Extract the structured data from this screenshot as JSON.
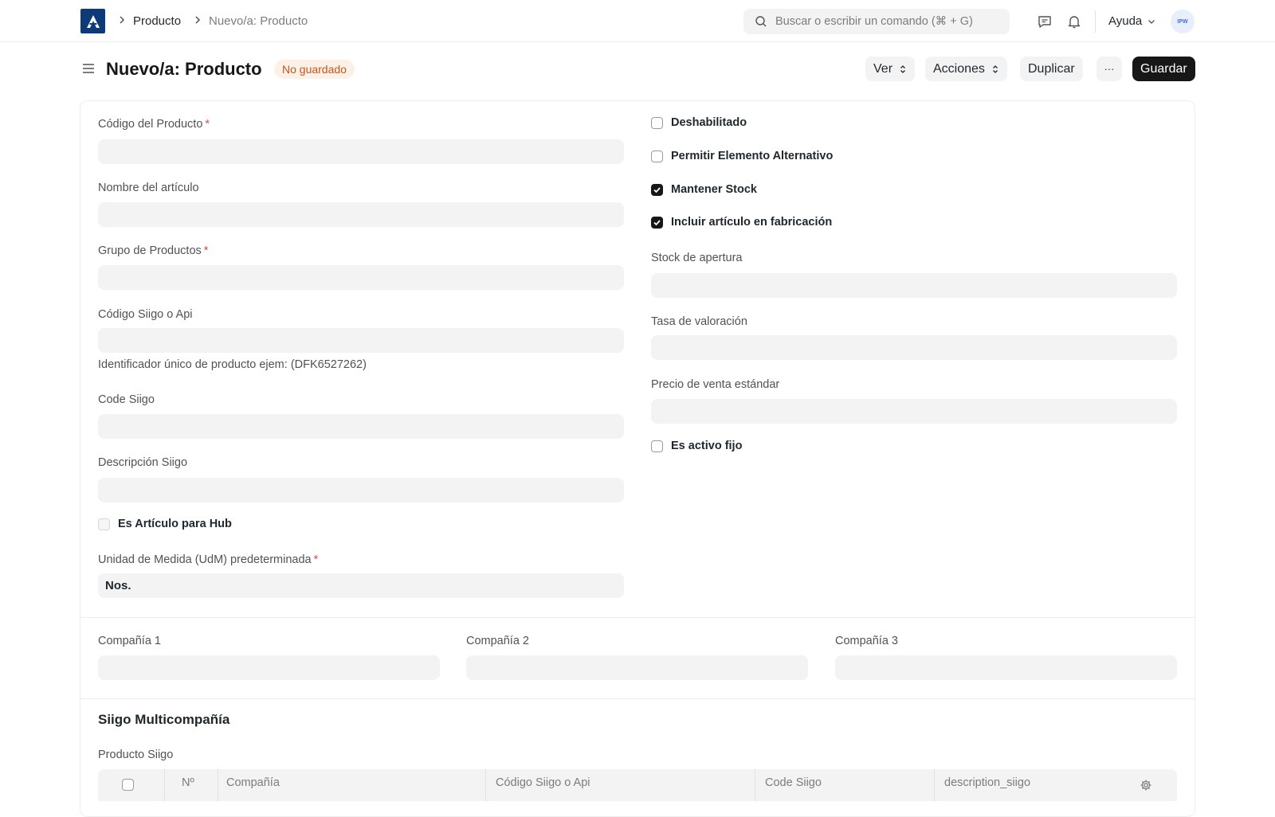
{
  "navbar": {
    "breadcrumb": [
      "Producto",
      "Nuevo/a: Producto"
    ],
    "search_placeholder": "Buscar o escribir un comando (⌘ + G)",
    "help_label": "Ayuda",
    "avatar_initials": "IPW"
  },
  "page": {
    "title": "Nuevo/a: Producto",
    "status": "No guardado",
    "buttons": {
      "view": "Ver",
      "actions": "Acciones",
      "duplicate": "Duplicar",
      "more": "···",
      "save": "Guardar"
    }
  },
  "form": {
    "left": {
      "item_code_label": "Código del Producto",
      "item_name_label": "Nombre del artículo",
      "item_group_label": "Grupo de Productos",
      "siigo_api_code_label": "Código Siigo o Api",
      "siigo_api_code_help": "Identificador único de producto ejem: (DFK6527262)",
      "code_siigo_label": "Code Siigo",
      "description_siigo_label": "Descripción Siigo",
      "hub_item_label": "Es Artículo para Hub",
      "uom_label": "Unidad de Medida (UdM) predeterminada",
      "uom_value": "Nos."
    },
    "right": {
      "disabled_label": "Deshabilitado",
      "allow_alternative_label": "Permitir Elemento Alternativo",
      "maintain_stock_label": "Mantener Stock",
      "include_manufacturing_label": "Incluir artículo en fabricación",
      "opening_stock_label": "Stock de apertura",
      "valuation_rate_label": "Tasa de valoración",
      "standard_rate_label": "Precio de venta estándar",
      "fixed_asset_label": "Es activo fijo"
    },
    "companies": {
      "company_1_label": "Compañía 1",
      "company_2_label": "Compañía 2",
      "company_3_label": "Compañía 3"
    },
    "siigo_section": {
      "title": "Siigo Multicompañía",
      "table_label": "Producto Siigo",
      "columns": [
        "Nº",
        "Compañía",
        "Código Siigo o Api",
        "Code Siigo",
        "description_siigo"
      ]
    }
  }
}
